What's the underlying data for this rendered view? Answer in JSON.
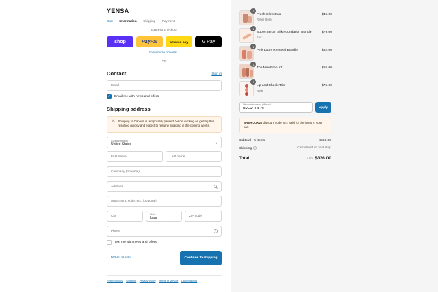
{
  "brand": "YENSA",
  "breadcrumb": {
    "cart": "Cart",
    "information": "Information",
    "shipping": "Shipping",
    "payment": "Payment",
    "sep": "›"
  },
  "express": {
    "label": "Express checkout",
    "buttons": {
      "shop": "shop",
      "paypal": "PayPal",
      "amazon": "amazon pay",
      "gpay": "G Pay"
    },
    "show_more": "Show more options ⌄",
    "or": "OR"
  },
  "contact": {
    "title": "Contact",
    "sign_in": "Sign in",
    "email_placeholder": "Email",
    "news_label": "Email me with news and offers",
    "news_checked": true
  },
  "shipping": {
    "title": "Shipping address",
    "notice": "Shipping to Canada is temporarily paused. We're working on getting this resolved quickly and expect to resume shipping in the coming weeks.",
    "country_label": "Country/Region",
    "country_value": "United States",
    "first_name": "First name",
    "last_name": "Last name",
    "company": "Company (optional)",
    "address": "Address",
    "apartment": "Apartment, suite, etc. (optional)",
    "city": "City",
    "state_label": "State",
    "state_value": "Iowa",
    "zip": "ZIP code",
    "phone": "Phone",
    "text_label": "Text me with news and offers",
    "text_checked": false
  },
  "nav": {
    "return": "Return to cart",
    "continue": "Continue to shipping"
  },
  "footer": [
    "Refund policy",
    "Shipping",
    "Privacy policy",
    "Terms of service",
    "Cancellations"
  ],
  "items": [
    {
      "name": "Fresh Glow Duo",
      "variant": "Rebel Rose",
      "price": "$45.00",
      "qty": "1"
    },
    {
      "name": "Super Serum Silk Foundation Bundle",
      "variant": "Fair 1",
      "price": "$79.00",
      "qty": "1"
    },
    {
      "name": "Pink Lotus Renewal Bundle",
      "variant": "",
      "price": "$82.00",
      "qty": "1"
    },
    {
      "name": "The Mini Prep Kit",
      "variant": "",
      "price": "$55.00",
      "qty": "1"
    },
    {
      "name": "Lip and Cheek Trio",
      "variant": "Nude",
      "price": "$75.00",
      "qty": "1"
    }
  ],
  "discount": {
    "label": "Discount code or gift card",
    "value": "BREROOK20",
    "apply": "Apply",
    "error_code": "BREROOK20",
    "error_text": " discount code isn't valid for the items in your cart"
  },
  "summary": {
    "subtotal_label": "Subtotal · 5 items",
    "subtotal": "$336.00",
    "shipping_label": "Shipping",
    "shipping_value": "Calculated at next step",
    "total_label": "Total",
    "currency": "USD",
    "total": "$336.00"
  },
  "colors": {
    "accent": "#1773b0",
    "shop": "#5a31f4",
    "paypal": "#ffc439",
    "amazon": "#ffd814",
    "notice_bg": "#fff5ea"
  }
}
